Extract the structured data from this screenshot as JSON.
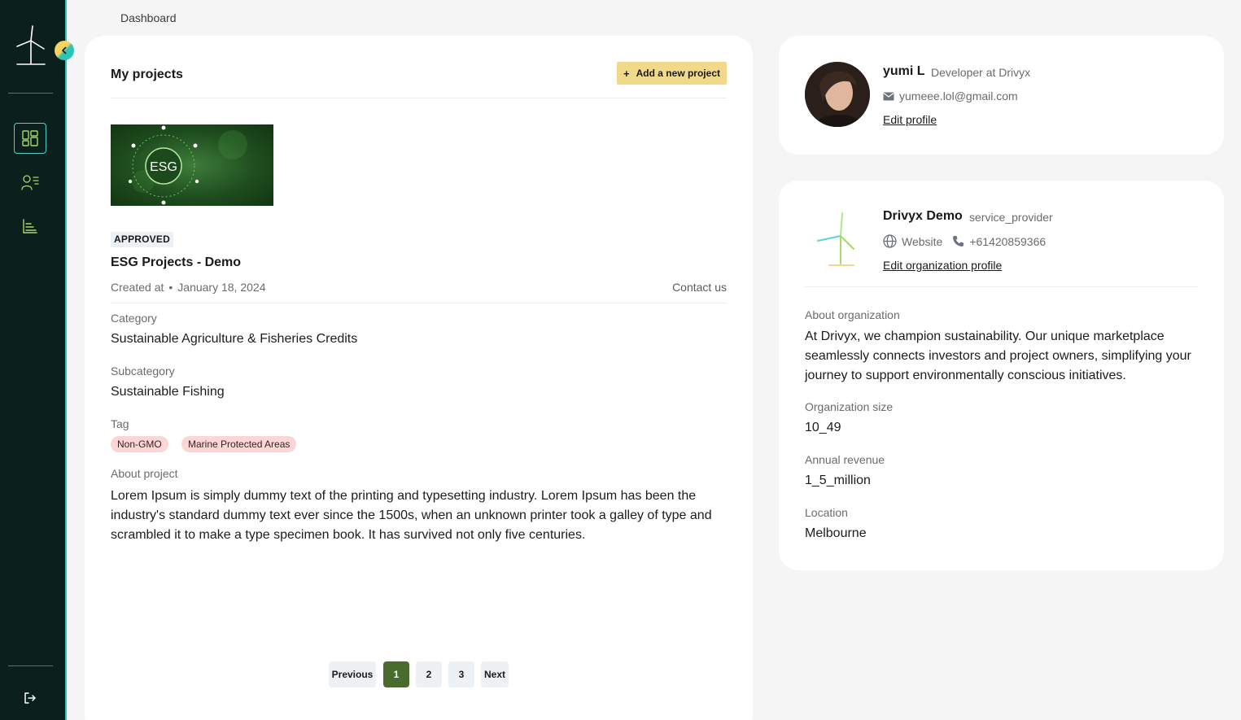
{
  "breadcrumb": "Dashboard",
  "projects": {
    "title": "My projects",
    "add_button": "Add a new project",
    "add_icon": "+",
    "thumbnail_text": "ESG",
    "status": "APPROVED",
    "name": "ESG Projects - Demo",
    "created_label": "Created at",
    "created_sep": "•",
    "created_date": "January 18, 2024",
    "contact": "Contact us",
    "category_label": "Category",
    "category": "Sustainable Agriculture & Fisheries Credits",
    "subcategory_label": "Subcategory",
    "subcategory": "Sustainable Fishing",
    "tag_label": "Tag",
    "tags": [
      "Non-GMO",
      "Marine Protected Areas"
    ],
    "about_label": "About project",
    "about": "Lorem Ipsum is simply dummy text of the printing and typesetting industry. Lorem Ipsum has been the industry's standard dummy text ever since the 1500s, when an unknown printer took a galley of type and scrambled it to make a type specimen book. It has survived not only five centuries."
  },
  "pagination": {
    "previous": "Previous",
    "pages": [
      "1",
      "2",
      "3"
    ],
    "current": "1",
    "next": "Next"
  },
  "profile": {
    "name": "yumi L",
    "role": "Developer at Drivyx",
    "email": "yumeee.lol@gmail.com",
    "edit": "Edit profile"
  },
  "organization": {
    "name": "Drivyx Demo",
    "type": "service_provider",
    "website": "Website",
    "phone": "+61420859366",
    "edit": "Edit organization profile",
    "about_label": "About organization",
    "about": "At Drivyx, we champion sustainability. Our unique marketplace seamlessly connects investors and project owners, simplifying your journey to support environmentally conscious initiatives.",
    "size_label": "Organization size",
    "size": "10_49",
    "revenue_label": "Annual revenue",
    "revenue": "1_5_million",
    "location_label": "Location",
    "location": "Melbourne"
  },
  "colors": {
    "sidebar_bg": "#0b1f1c",
    "accent_teal": "#2ec4b6",
    "accent_yellow": "#f0d98a",
    "active_page": "#4a6b2e",
    "tag_bg": "#fad6d6"
  },
  "icons": {
    "logo": "wind-turbine-icon",
    "nav": [
      "dashboard-icon",
      "users-list-icon",
      "chart-icon"
    ],
    "logout": "logout-icon",
    "toggle": "chevron-left-icon",
    "email": "mail-icon",
    "website": "globe-icon",
    "phone": "phone-icon"
  }
}
